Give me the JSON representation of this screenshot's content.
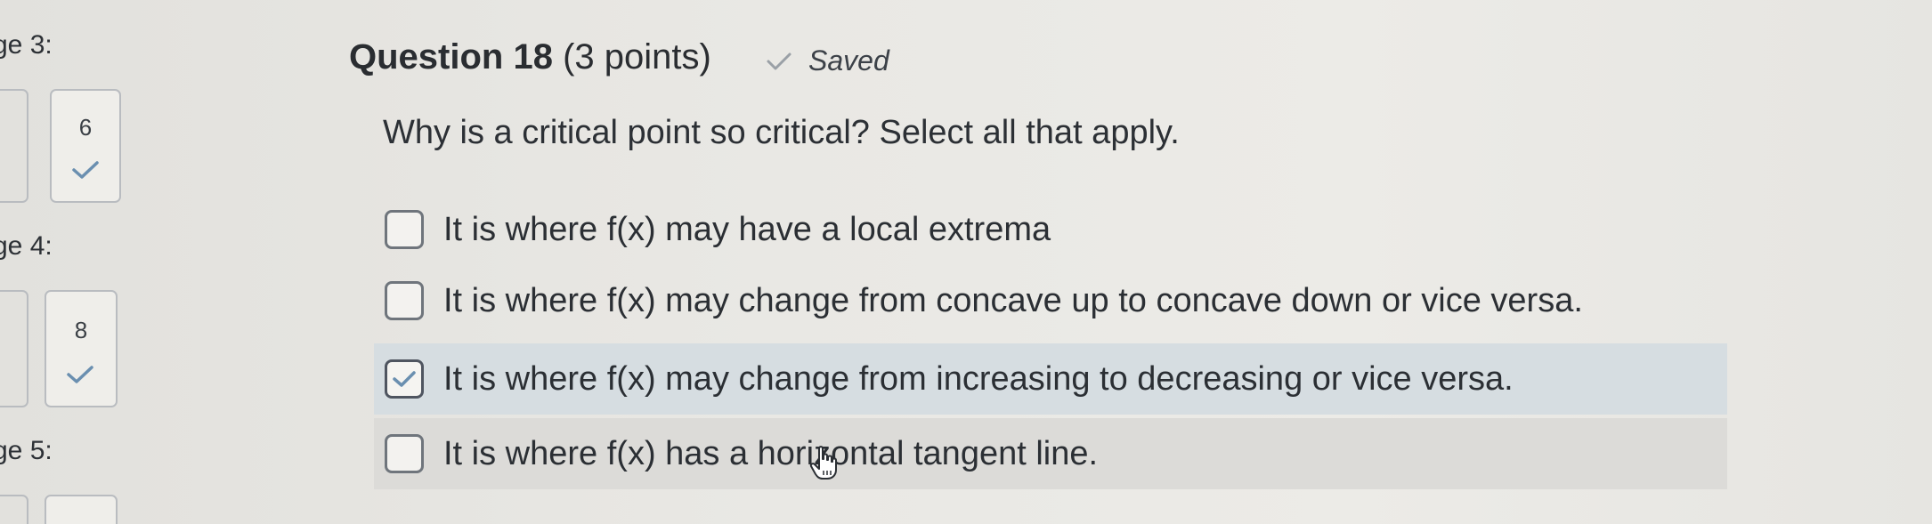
{
  "nav": {
    "pages": [
      {
        "label": "ge 3:",
        "tile_num": "6",
        "answered": true
      },
      {
        "label": "ge 4:",
        "tile_num": "8",
        "answered": true
      },
      {
        "label": "ge 5:"
      }
    ]
  },
  "question": {
    "title": "Question 18",
    "points": "(3 points)",
    "status": "Saved",
    "prompt": "Why is a critical point so critical? Select all that apply.",
    "options": [
      {
        "label": "It is where f(x) may have a local extrema",
        "checked": false
      },
      {
        "label": "It is where f(x) may change from concave up to concave down or vice versa.",
        "checked": false
      },
      {
        "label": "It is where f(x) may change from increasing to decreasing or vice versa.",
        "checked": true
      },
      {
        "label": "It is where f(x) has a horizontal tangent line.",
        "checked": false
      }
    ]
  },
  "colors": {
    "checkmark": "#6a8fb0",
    "highlight_selected": "#d6dde1",
    "highlight_hover": "#dcdbd8"
  },
  "icons": {
    "saved": "check-icon",
    "answered": "check-icon",
    "cursor": "hand-pointer-icon"
  }
}
